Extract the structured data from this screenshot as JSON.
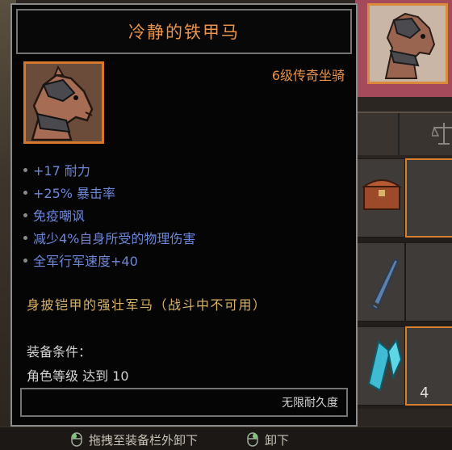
{
  "item": {
    "name": "冷静的铁甲马",
    "rarity": "6级传奇坐骑",
    "stats": [
      "+17 耐力",
      "+25% 暴击率",
      "免疫嘲讽",
      "减少4%自身所受的物理伤害",
      "全军行军速度+40"
    ],
    "flavor": "身披铠甲的强壮军马（战斗中不可用）",
    "requirement_label": "装备条件：",
    "requirement_value": "角色等级 达到 10",
    "durability": "无限耐久度",
    "icon": "armored-horse-icon"
  },
  "inventory": {
    "stack_count": "4"
  },
  "hints": {
    "drag_unequip": "拖拽至装备栏外卸下",
    "unequip": "卸下"
  },
  "colors": {
    "title_orange": "#e8924b",
    "stat_blue": "#6e86d8",
    "flavor_gold": "#d9b26a",
    "frame_orange": "#d4782f"
  }
}
